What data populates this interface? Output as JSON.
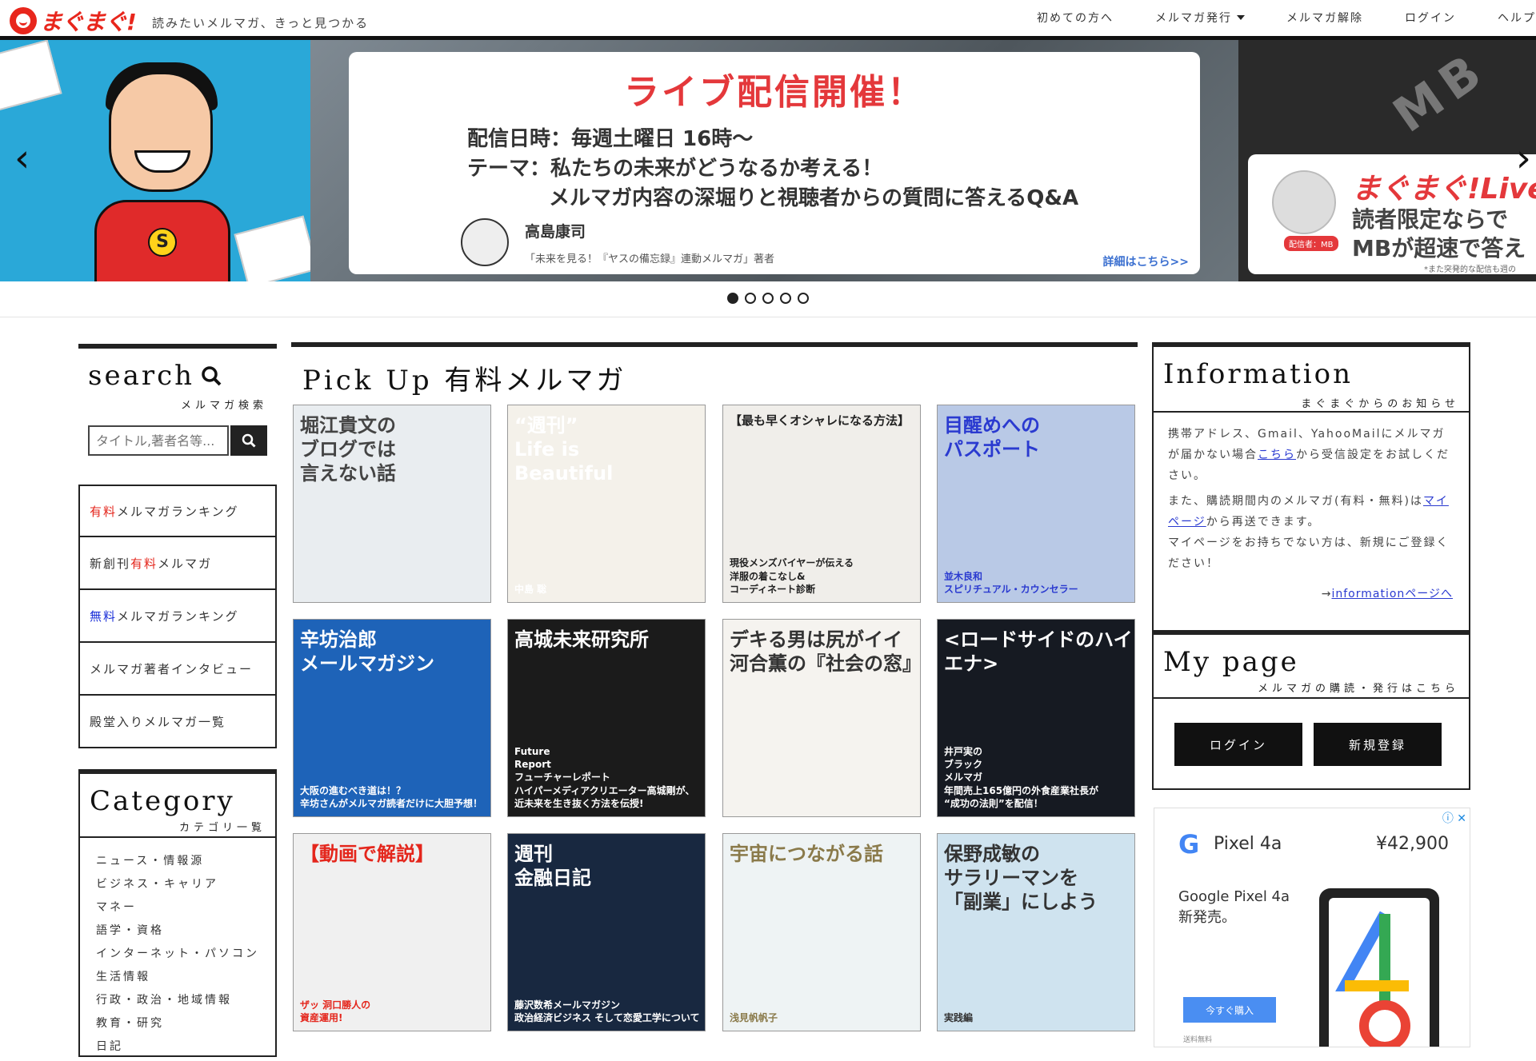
{
  "header": {
    "logo_text": "まぐまぐ!",
    "tagline": "読みたいメルマガ、きっと見つかる",
    "nav": [
      {
        "label": "初めての方へ",
        "dropdown": false
      },
      {
        "label": "メルマガ発行",
        "dropdown": true
      },
      {
        "label": "メルマガ解除",
        "dropdown": false
      },
      {
        "label": "ログイン",
        "dropdown": false
      },
      {
        "label": "ヘルプ",
        "dropdown": false
      }
    ]
  },
  "carousel": {
    "prev_label": "‹",
    "next_label": "›",
    "left_badge": "S",
    "main": {
      "title": "ライブ配信開催！",
      "line1": "配信日時：毎週土曜日 16時〜",
      "line2": "テーマ：私たちの未来がどうなるか考える！",
      "line3": "メルマガ内容の深堀りと視聴者からの質問に答えるQ&A",
      "author": "高島康司",
      "author_sub": "「未来を見る！『ヤスの備忘録』連動メルマガ」著者",
      "link": "詳細はこちら>>"
    },
    "right": {
      "letters": "MB",
      "title": "まぐまぐ!Live",
      "line1": "読者限定ならで",
      "line2": "MBが超速で答え",
      "tag": "配信者：MB",
      "note": "*また突発的な配信も週の"
    },
    "dots": [
      true,
      false,
      false,
      false,
      false
    ]
  },
  "search": {
    "title": "search",
    "subtitle": "メルマガ検索",
    "placeholder": "タイトル,著者名等..."
  },
  "menu": [
    {
      "pre": "",
      "hl": "有料",
      "hl_color": "red",
      "post": "メルマガランキング"
    },
    {
      "pre": "新創刊",
      "hl": "有料",
      "hl_color": "red",
      "post": "メルマガ"
    },
    {
      "pre": "",
      "hl": "無料",
      "hl_color": "blue",
      "post": "メルマガランキング"
    },
    {
      "pre": "メルマガ著者インタビュー",
      "hl": "",
      "hl_color": "",
      "post": ""
    },
    {
      "pre": "殿堂入りメルマガ一覧",
      "hl": "",
      "hl_color": "",
      "post": ""
    }
  ],
  "category": {
    "title": "Category",
    "subtitle": "カテゴリ一覧",
    "items": [
      "ニュース・情報源",
      "ビジネス・キャリア",
      "マネー",
      "語学・資格",
      "インターネット・パソコン",
      "生活情報",
      "行政・政治・地域情報",
      "教育・研究",
      "日記"
    ]
  },
  "pickup": {
    "title": "Pick Up 有料メルマガ",
    "items": [
      {
        "text": "堀江貴文の\nブログでは\n言えない話",
        "bg": "#e9edf0",
        "color": "#444",
        "caption": ""
      },
      {
        "text": "“週刊”\nLife is\nBeautiful",
        "bg": "#f4f1ea",
        "color": "#fff",
        "caption": "中島 聡"
      },
      {
        "text": "【最も早くオシャレになる方法】",
        "bg": "#f0eeea",
        "color": "#222",
        "caption": "現役メンズバイヤーが伝える\n洋服の着こなし&\nコーディネート診断"
      },
      {
        "text": "目醒めへの\nパスポート",
        "bg": "#b9c9e6",
        "color": "#2a3ad0",
        "caption": "並木良和\nスピリチュアル・カウンセラー"
      },
      {
        "text": "辛坊治郎\nメールマガジン",
        "bg": "#1e63b8",
        "color": "#fff",
        "caption": "大阪の進むべき道は！？\n辛坊さんがメルマガ読者だけに大胆予想！"
      },
      {
        "text": "高城未来研究所",
        "bg": "#1b1b1b",
        "color": "#fff",
        "caption": "Future\nReport\nフューチャーレポート\nハイパーメディアクリエーター高城剛が、\n近未来を生き抜く方法を伝授!"
      },
      {
        "text": "デキる男は尻がイイ\n河合薫の『社会の窓』",
        "bg": "#f5f3ef",
        "color": "#333",
        "caption": ""
      },
      {
        "text": "<ロードサイドのハイエナ>",
        "bg": "#161a22",
        "color": "#fff",
        "caption": "井戸実の\nブラック\nメルマガ\n年間売上165億円の外食産業社長が\n“成功の法則”を配信！"
      },
      {
        "text": "【動画で解説】",
        "bg": "#f0f0f0",
        "color": "#e4261c",
        "caption": "ザッ 洞口勝人の\n資産運用!"
      },
      {
        "text": "週刊\n金融日記",
        "bg": "#182840",
        "color": "#fff",
        "caption": "藤沢数希メールマガジン\n政治経済ビジネス そして恋愛工学について"
      },
      {
        "text": "宇宙につながる話",
        "bg": "#eef3f4",
        "color": "#8a7a4a",
        "caption": "浅見帆帆子"
      },
      {
        "text": "保野成敏の\nサラリーマンを\n「副業」にしよう",
        "bg": "#cfe3ef",
        "color": "#333",
        "caption": "実践編"
      }
    ]
  },
  "information": {
    "title": "Information",
    "subtitle": "まぐまぐからのお知らせ",
    "p1_pre": "携帯アドレス、Gmail、YahooMailにメルマガが届かない場合",
    "p1_link": "こちら",
    "p1_post": "から受信設定をお試しください。",
    "p2_pre": "また、購読期間内のメルマガ(有料・無料)は",
    "p2_link": "マイページ",
    "p2_post": "から再送できます。",
    "p3": "マイページをお持ちでない方は、新規にご登録ください！",
    "more_prefix": "→",
    "more_link": "informationページへ"
  },
  "mypage": {
    "title": "My page",
    "subtitle": "メルマガの購読・発行はこちら",
    "login": "ログイン",
    "register": "新規登録"
  },
  "ad": {
    "g": "G",
    "product": "Pixel 4a",
    "price": "¥42,900",
    "headline": "Google Pixel 4a\n新発売。",
    "button": "今すぐ購入",
    "note": "送料無料",
    "badge": "ⓘ ✕"
  }
}
